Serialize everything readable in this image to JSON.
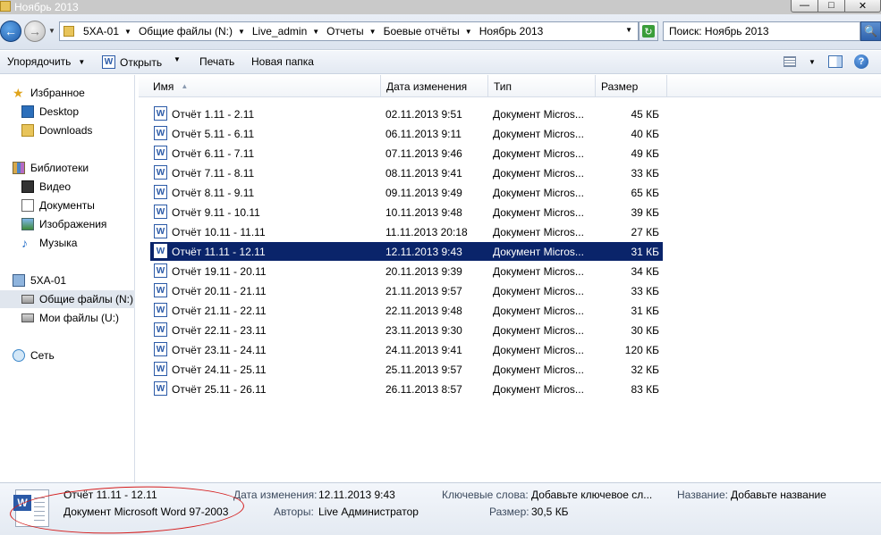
{
  "window": {
    "title": "Ноябрь 2013",
    "minimize": "—",
    "maximize": "□",
    "close": "✕"
  },
  "address": {
    "breadcrumbs": [
      "5XA-01",
      "Общие файлы (N:)",
      "Live_admin",
      "Отчеты",
      "Боевые отчёты",
      "Ноябрь 2013"
    ],
    "search_placeholder": "Поиск: Ноябрь 2013"
  },
  "toolbar": {
    "organize": "Упорядочить",
    "open": "Открыть",
    "print": "Печать",
    "new_folder": "Новая папка"
  },
  "nav": {
    "favorites": "Избранное",
    "desktop": "Desktop",
    "downloads": "Downloads",
    "libraries": "Библиотеки",
    "video": "Видео",
    "documents": "Документы",
    "images": "Изображения",
    "music": "Музыка",
    "computer": "5XA-01",
    "shared": "Общие файлы (N:)",
    "myfiles": "Мои файлы (U:)",
    "network": "Сеть"
  },
  "columns": {
    "name": "Имя",
    "date": "Дата изменения",
    "type": "Тип",
    "size": "Размер"
  },
  "files": [
    {
      "name": "Отчёт 1.11 - 2.11",
      "date": "02.11.2013 9:51",
      "type": "Документ Micros...",
      "size": "45 КБ"
    },
    {
      "name": "Отчёт 5.11 - 6.11",
      "date": "06.11.2013 9:11",
      "type": "Документ Micros...",
      "size": "40 КБ"
    },
    {
      "name": "Отчёт 6.11 - 7.11",
      "date": "07.11.2013 9:46",
      "type": "Документ Micros...",
      "size": "49 КБ"
    },
    {
      "name": "Отчёт 7.11 - 8.11",
      "date": "08.11.2013 9:41",
      "type": "Документ Micros...",
      "size": "33 КБ"
    },
    {
      "name": "Отчёт 8.11 - 9.11",
      "date": "09.11.2013 9:49",
      "type": "Документ Micros...",
      "size": "65 КБ"
    },
    {
      "name": "Отчёт 9.11 - 10.11",
      "date": "10.11.2013 9:48",
      "type": "Документ Micros...",
      "size": "39 КБ"
    },
    {
      "name": "Отчёт 10.11 - 11.11",
      "date": "11.11.2013 20:18",
      "type": "Документ Micros...",
      "size": "27 КБ"
    },
    {
      "name": "Отчёт 11.11 - 12.11",
      "date": "12.11.2013 9:43",
      "type": "Документ Micros...",
      "size": "31 КБ",
      "selected": true
    },
    {
      "name": "Отчёт 19.11 - 20.11",
      "date": "20.11.2013 9:39",
      "type": "Документ Micros...",
      "size": "34 КБ"
    },
    {
      "name": "Отчёт 20.11 - 21.11",
      "date": "21.11.2013 9:57",
      "type": "Документ Micros...",
      "size": "33 КБ"
    },
    {
      "name": "Отчёт 21.11 - 22.11",
      "date": "22.11.2013 9:48",
      "type": "Документ Micros...",
      "size": "31 КБ"
    },
    {
      "name": "Отчёт 22.11 - 23.11",
      "date": "23.11.2013 9:30",
      "type": "Документ Micros...",
      "size": "30 КБ"
    },
    {
      "name": "Отчёт 23.11 - 24.11",
      "date": "24.11.2013 9:41",
      "type": "Документ Micros...",
      "size": "120 КБ"
    },
    {
      "name": "Отчёт 24.11 - 25.11",
      "date": "25.11.2013 9:57",
      "type": "Документ Micros...",
      "size": "32 КБ"
    },
    {
      "name": "Отчёт 25.11 - 26.11",
      "date": "26.11.2013 8:57",
      "type": "Документ Micros...",
      "size": "83 КБ"
    }
  ],
  "details": {
    "filename": "Отчёт 11.11 - 12.11",
    "filetype": "Документ Microsoft Word 97-2003",
    "modified_label": "Дата изменения:",
    "modified_value": "12.11.2013 9:43",
    "authors_label": "Авторы:",
    "authors_value": "Live Администратор",
    "keywords_label": "Ключевые слова:",
    "keywords_value": "Добавьте ключевое сл...",
    "size_label": "Размер:",
    "size_value": "30,5 КБ",
    "title_label": "Название:",
    "title_value": "Добавьте название"
  },
  "icons": {
    "word": "W",
    "help": "?",
    "back": "←",
    "forward": "→",
    "search": "🔍",
    "refresh": "↻",
    "star": "★",
    "music": "♪",
    "caret": "▼",
    "sort": "▲"
  },
  "colors": {
    "selection": "#0a246a",
    "annotation": "#d41b1b"
  }
}
